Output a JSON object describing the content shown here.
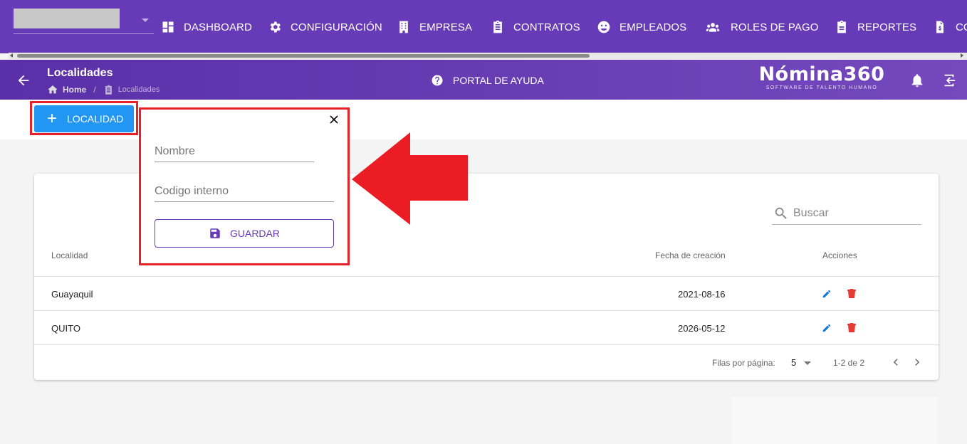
{
  "topnav": {
    "company_select_value": "",
    "items": [
      {
        "label": "DASHBOARD",
        "icon": "dashboard-icon"
      },
      {
        "label": "CONFIGURACIÓN",
        "icon": "gear-icon"
      },
      {
        "label": "EMPRESA",
        "icon": "building-icon"
      },
      {
        "label": "CONTRATOS",
        "icon": "clipboard-icon"
      },
      {
        "label": "EMPLEADOS",
        "icon": "face-icon"
      },
      {
        "label": "ROLES DE PAGO",
        "icon": "group-icon"
      },
      {
        "label": "REPORTES",
        "icon": "report-icon"
      },
      {
        "label": "CO",
        "icon": "invoice-icon"
      }
    ]
  },
  "header": {
    "title": "Localidades",
    "breadcrumb_home": "Home",
    "breadcrumb_sep": "/",
    "breadcrumb_current": "Localidades",
    "help_label": "PORTAL DE AYUDA",
    "logo_name": "Nómina360",
    "logo_tagline": "SOFTWARE DE TALENTO HUMANO"
  },
  "toolbar": {
    "add_label": "LOCALIDAD"
  },
  "popup": {
    "nombre_placeholder": "Nombre",
    "codigo_placeholder": "Codigo interno",
    "save_label": "GUARDAR"
  },
  "table": {
    "search_placeholder": "Buscar",
    "headers": {
      "localidad": "Localidad",
      "fecha": "Fecha de creación",
      "acciones": "Acciones"
    },
    "rows": [
      {
        "localidad": "Guayaquil",
        "fecha": "2021-08-16"
      },
      {
        "localidad": "QUITO",
        "fecha": "2026-05-12"
      }
    ],
    "rows_per_page_label": "Filas por página:",
    "rows_per_page_value": "5",
    "range_text": "1-2 de 2"
  },
  "colors": {
    "primary": "#673ab7",
    "accent_button": "#2196f3",
    "highlight": "#e8202a",
    "edit_icon": "#1976d2",
    "delete_icon": "#e53935"
  }
}
